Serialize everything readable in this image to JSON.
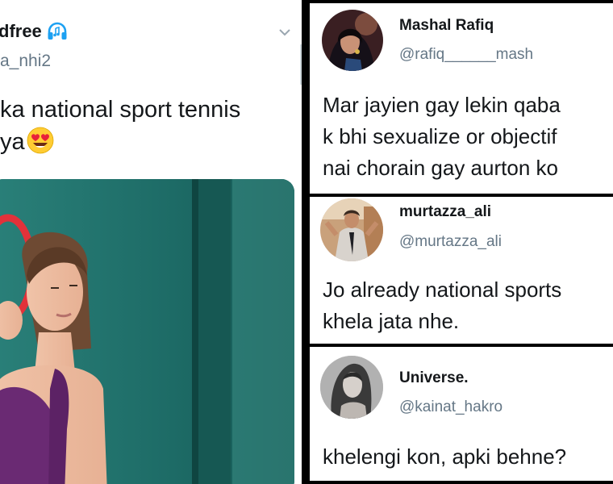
{
  "left_tweet": {
    "name": "dfree",
    "handle": "a_nhi2",
    "text_lines": [
      "ka national sport tennis",
      "ya"
    ],
    "emoji": "heart-eyes-emoji",
    "icon": "headphones-icon"
  },
  "tweets": [
    {
      "name": "Mashal Rafiq",
      "handle": "@rafiq______mash",
      "text_lines": [
        "Mar jayien gay lekin qaba",
        "k bhi sexualize or objectif",
        "nai chorain gay aurton ko"
      ]
    },
    {
      "name": "murtazza_ali",
      "handle": "@murtazza_ali",
      "text_lines": [
        "Jo already national sports",
        "khela jata nhe."
      ]
    },
    {
      "name": "Universe.",
      "handle": "@kainat_hakro",
      "text_lines": [
        "khelengi kon, apki behne?"
      ]
    }
  ],
  "colors": {
    "name": "#14171a",
    "handle": "#657786",
    "background": "#000000"
  }
}
